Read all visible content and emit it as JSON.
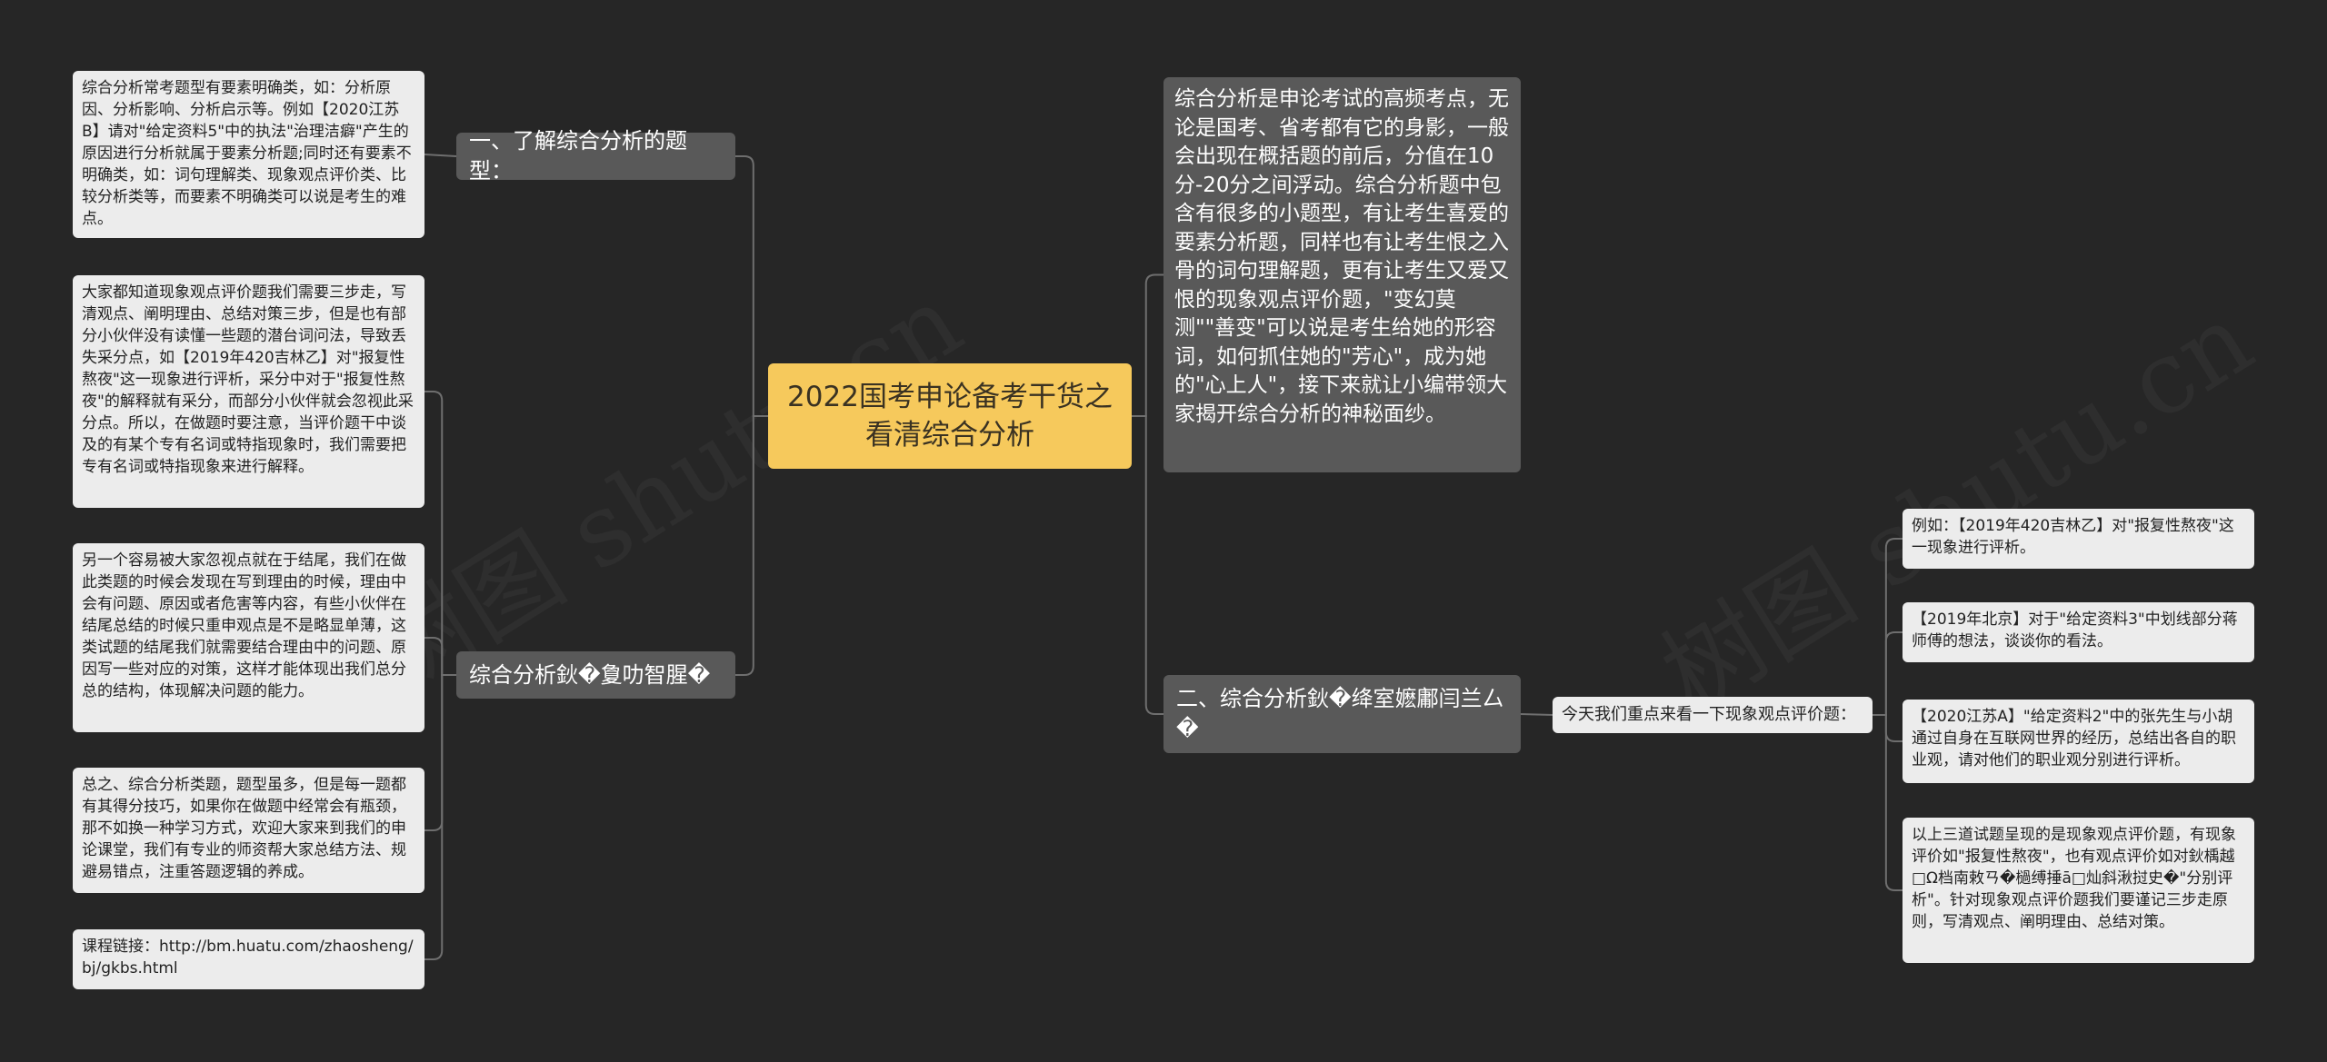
{
  "root": {
    "title": "2022国考申论备考干货之看清综合分析"
  },
  "right": {
    "intro": "综合分析是申论考试的高频考点，无论是国考、省考都有它的身影，一般会出现在概括题的前后，分值在10分-20分之间浮动。综合分析题中包含有很多的小题型，有让考生喜爱的要素分析题，同样也有让考生恨之入骨的词句理解题，更有让考生又爱又恨的现象观点评价题，\"变幻莫测\"\"善变\"可以说是考生给她的形容词，如何抓住她的\"芳心\"，成为她的\"心上人\"，接下来就让小编带领大家揭开综合分析的神秘面纱。",
    "branch2": "二、综合分析鈥�绛室嬷鄘闫兰厶�",
    "sub": "今天我们重点来看一下现象观点评价题：",
    "examples": [
      "例如：【2019年420吉林乙】对\"报复性熬夜\"这一现象进行评析。",
      "【2019年北京】对于\"给定资料3\"中划线部分蒋师傅的想法，谈谈你的看法。",
      "【2020江苏A】\"给定资料2\"中的张先生与小胡通过自身在互联网世界的经历，总结出各自的职业观，请对他们的职业观分别进行评析。",
      "以上三道试题呈现的是现象观点评价题，有现象评价如\"报复性熬夜\"，也有观点评价如对鈥楀越□Ω档南敕ㄢ�檛缚捶ā□灿斜湫挝史�\"分别评析\"。针对现象观点评价题我们要谨记三步走原则，写清观点、阐明理由、总结对策。"
    ]
  },
  "left": {
    "branch1": "一、了解综合分析的题型：",
    "branch1_leaf": "综合分析常考题型有要素明确类，如：分析原因、分析影响、分析启示等。例如【2020江苏B】请对\"给定资料5\"中的执法\"治理洁癖\"产生的原因进行分析就属于要素分析题;同时还有要素不明确类，如：词句理解类、现象观点评价类、比较分析类等，而要素不明确类可以说是考生的难点。",
    "branch3": "综合分析鈥�夐叻智腥�",
    "leaves": [
      "大家都知道现象观点评价题我们需要三步走，写清观点、阐明理由、总结对策三步，但是也有部分小伙伴没有读懂一些题的潜台词问法，导致丢失采分点，如【2019年420吉林乙】对\"报复性熬夜\"这一现象进行评析，采分中对于\"报复性熬夜\"的解释就有采分，而部分小伙伴就会忽视此采分点。所以，在做题时要注意，当评价题干中谈及的有某个专有名词或特指现象时，我们需要把专有名词或特指现象来进行解释。",
      "另一个容易被大家忽视点就在于结尾，我们在做此类题的时候会发现在写到理由的时候，理由中会有问题、原因或者危害等内容，有些小伙伴在结尾总结的时候只重申观点是不是略显单薄，这类试题的结尾我们就需要结合理由中的问题、原因写一些对应的对策，这样才能体现出我们总分总的结构，体现解决问题的能力。",
      "总之、综合分析类题，题型虽多，但是每一题都有其得分技巧，如果你在做题中经常会有瓶颈，那不如换一种学习方式，欢迎大家来到我们的申论课堂，我们有专业的师资帮大家总结方法、规避易错点，注重答题逻辑的养成。",
      "课程链接：http://bm.huatu.com/zhaosheng/bj/gkbs.html"
    ]
  },
  "watermark": [
    "树图 shutu.cn",
    "树图 shutu.cn",
    "树图 shutu.cn"
  ],
  "colors": {
    "background": "#262626",
    "root": "#f6c95c",
    "branch": "#595959",
    "leaf": "#ececec",
    "line": "#6e6e6e"
  }
}
